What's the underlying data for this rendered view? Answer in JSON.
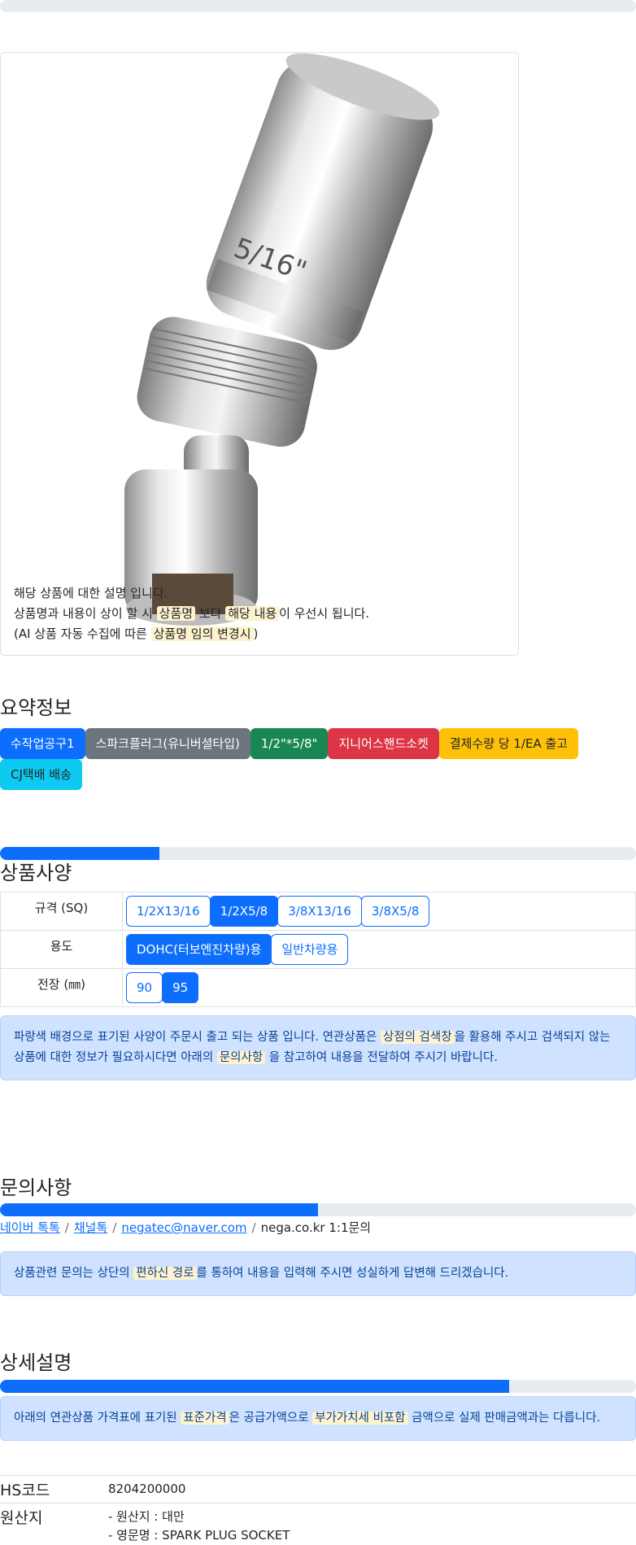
{
  "product_image": {
    "alt": "universal joint spark plug socket"
  },
  "description": {
    "line1": "해당 상품에 대한 설명 입니다.",
    "line2_pre": "상품명과 내용이 상이 할 시 ",
    "line2_hl1": "상품명",
    "line2_mid": " 보다 ",
    "line2_hl2": "해당 내용",
    "line2_post": "이 우선시 됩니다.",
    "line3_pre": "(AI 상품 자동 수집에 따른 ",
    "line3_hl": "상품명 임의 변경시",
    "line3_post": ")"
  },
  "summary": {
    "title": "요약정보",
    "badges": [
      {
        "label": "수작업공구1",
        "color": "#0d6efd"
      },
      {
        "label": "스파크플러그(유니버셜타입)",
        "color": "#6c757d"
      },
      {
        "label": "1/2\"*5/8\"",
        "color": "#198754"
      },
      {
        "label": "지니어스핸드소켓",
        "color": "#dc3545"
      },
      {
        "label": "결제수량 당 1/EA 출고",
        "color": "#ffc107"
      },
      {
        "label": "CJ택배 배송",
        "color": "#0dcaf0"
      }
    ]
  },
  "spec": {
    "title": "상품사양",
    "progress": 0.25,
    "rows": [
      {
        "label": "규격 (SQ)",
        "options": [
          "1/2X13/16",
          "1/2X5/8",
          "3/8X13/16",
          "3/8X5/8"
        ],
        "selected": 1
      },
      {
        "label": "용도",
        "options": [
          "DOHC(터보엔진차량)용",
          "일반차량용"
        ],
        "selected": 0
      },
      {
        "label": "전장 (㎜)",
        "options": [
          "90",
          "95"
        ],
        "selected": 1
      }
    ],
    "notice": {
      "pre": "파랑색 배경으로 표기된 사양이 주문시 출고 되는 상품 입니다. 연관상품은 ",
      "hl1": "상점의 검색창",
      "mid": "을 활용해 주시고 검색되지 않는 상품에 대한 정보가 필요하시다면 아래의 ",
      "hl2": "문의사항",
      "post": " 을 참고하여 내용을 전달하여 주시기 바랍니다."
    }
  },
  "inquiry": {
    "title": "문의사항",
    "progress": 0.5,
    "links": [
      "네이버 톡톡",
      "채널톡",
      "negatec@naver.com"
    ],
    "plain": "nega.co.kr 1:1문의",
    "notice": {
      "pre": "상품관련 문의는 상단의 ",
      "hl": "편하신 경로",
      "post": "를 통하여 내용을 입력해 주시면 성실하게 답변해 드리겠습니다."
    }
  },
  "detail": {
    "title": "상세설명",
    "progress": 0.8,
    "notice": {
      "pre": "아래의 연관상품 가격표에 표기된 ",
      "hl1": "표준가격",
      "mid": "은 공급가액으로 ",
      "hl2": "부가가치세 비포함",
      "post": " 금액으로 실제 판매금액과는 다릅니다."
    },
    "hs_label": "HS코드",
    "hs_value": "8204200000",
    "origin_label": "원산지",
    "origin_line1": "- 원산지 : 대만",
    "origin_line2": "- 영문명 : SPARK PLUG SOCKET"
  }
}
